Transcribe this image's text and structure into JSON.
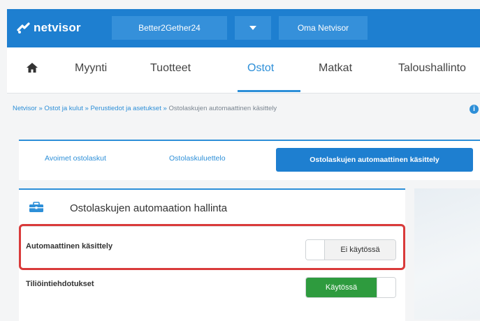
{
  "brand": {
    "name": "netvisor",
    "accent": "#1e7fd0"
  },
  "topbar": {
    "company": "Better2Gether24",
    "arrow_icon": "caret-down-icon",
    "oma": "Oma Netvisor"
  },
  "nav": {
    "home_icon": "home-icon",
    "items": [
      {
        "label": "Myynti"
      },
      {
        "label": "Tuotteet"
      },
      {
        "label": "Ostot"
      },
      {
        "label": "Matkat"
      },
      {
        "label": "Taloushallinto"
      }
    ],
    "active": "Ostot"
  },
  "breadcrumb": {
    "items": [
      "Netvisor",
      "Ostot ja kulut",
      "Perustiedot ja asetukset"
    ],
    "separator": "»",
    "current": "Ostolaskujen automaattinen käsittely"
  },
  "subtabs": {
    "items": [
      {
        "label": "Avoimet ostolaskut"
      },
      {
        "label": "Ostolaskuluettelo"
      }
    ],
    "active": "Ostolaskujen automaattinen käsittely"
  },
  "panel": {
    "title": "Ostolaskujen automaation hallinta",
    "icon": "briefcase-icon",
    "rows": [
      {
        "label": "Automaattinen käsittely",
        "toggle_label": "Ei käytössä",
        "enabled": false
      },
      {
        "label": "Tiliöintiehdotukset",
        "toggle_label": "Käytössä",
        "enabled": true
      }
    ]
  },
  "colors": {
    "highlight": "#d93a3a",
    "on": "#2e9b3e"
  }
}
